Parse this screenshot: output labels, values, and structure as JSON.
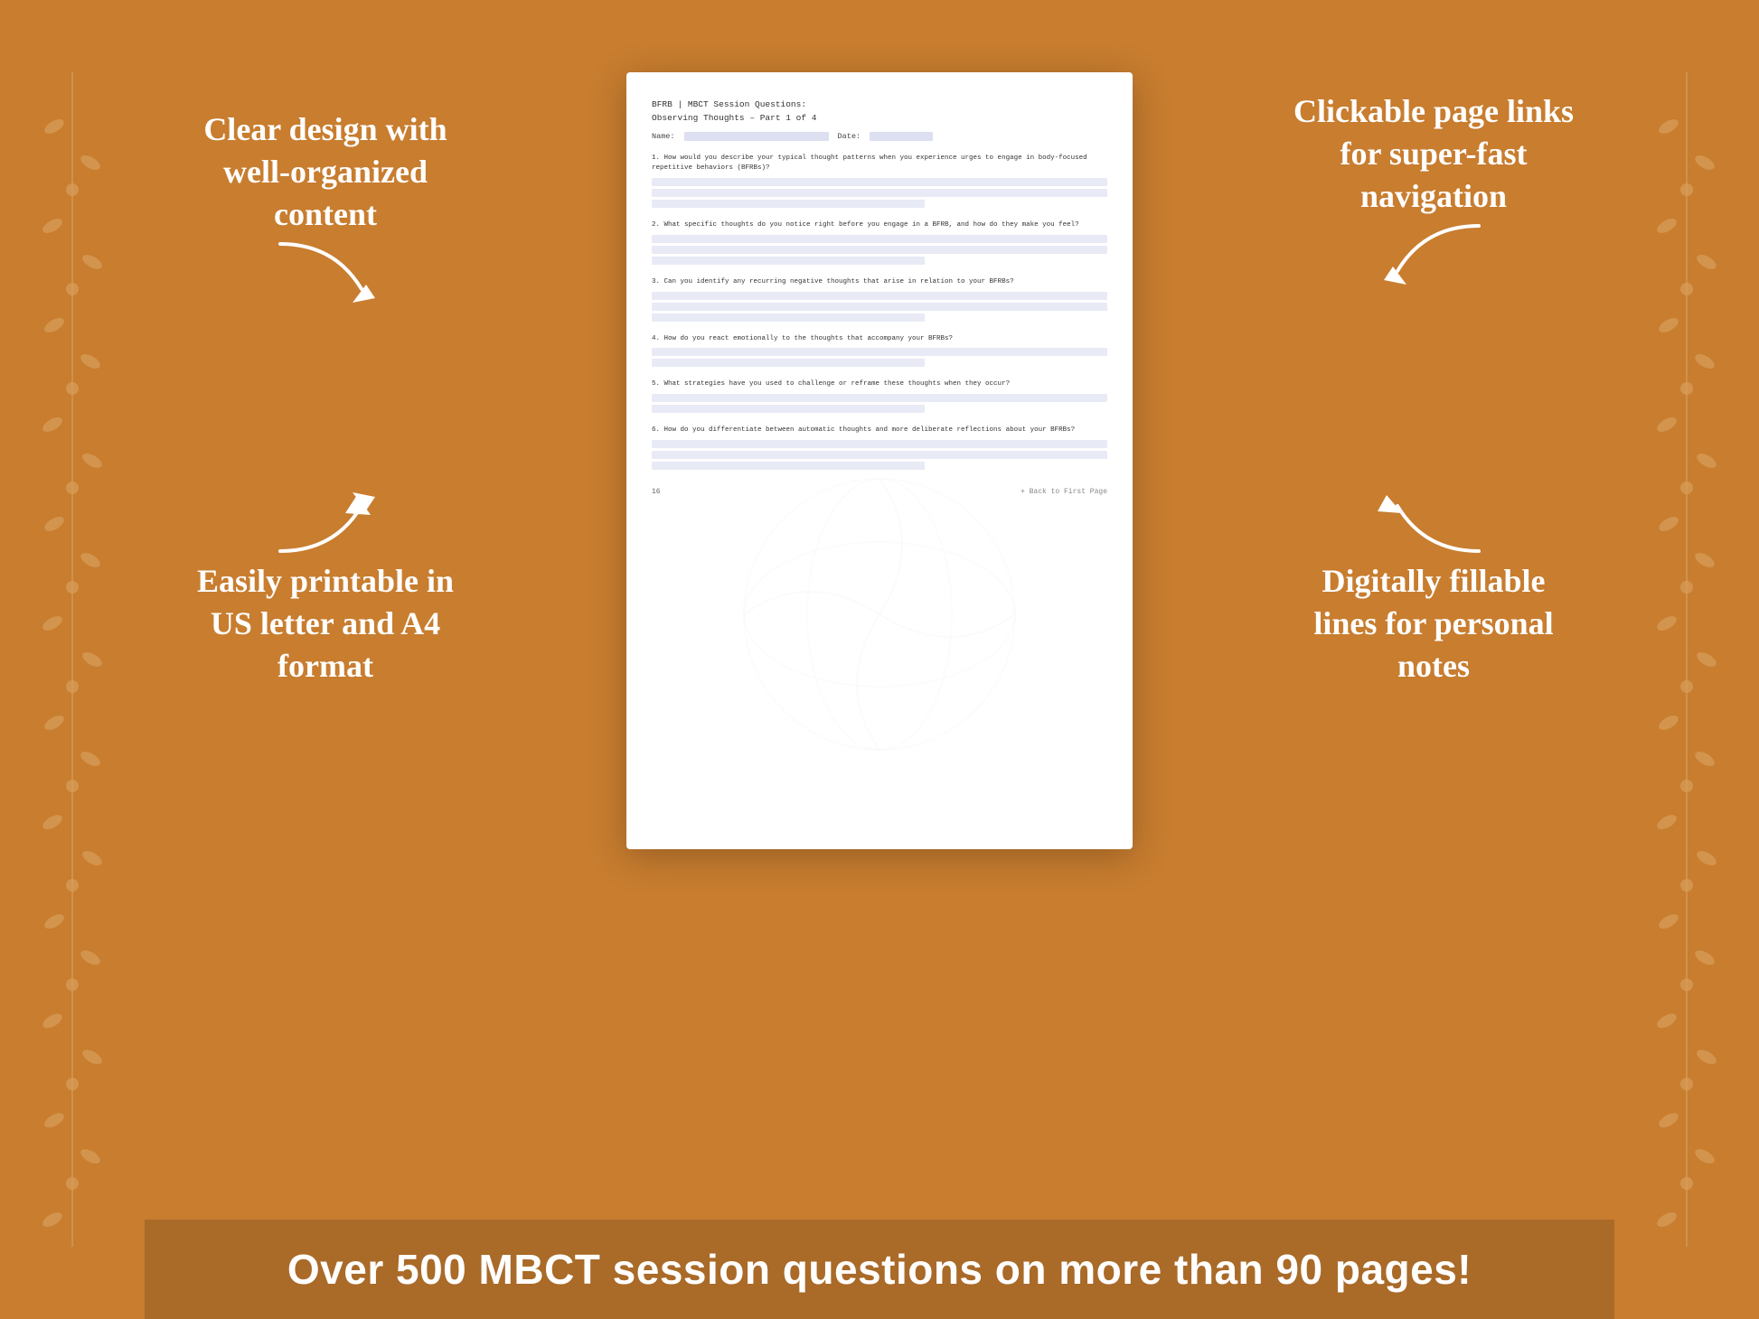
{
  "background_color": "#C87D2F",
  "left_annotations": {
    "top": {
      "text": "Clear design with well-organized content",
      "arrow_direction": "down-right"
    },
    "bottom": {
      "text": "Easily printable in US letter and A4 format",
      "arrow_direction": "down-right"
    }
  },
  "right_annotations": {
    "top": {
      "text": "Clickable page links for super-fast navigation",
      "arrow_direction": "left"
    },
    "bottom": {
      "text": "Digitally fillable lines for personal notes",
      "arrow_direction": "left"
    }
  },
  "document": {
    "header": "BFRB | MBCT Session Questions:",
    "title": "Observing Thoughts  – Part 1 of 4",
    "name_label": "Name:",
    "date_label": "Date:",
    "questions": [
      {
        "number": "1.",
        "text": "How would you describe your typical thought patterns when you experience urges to engage\nin body-focused repetitive behaviors (BFRBs)?",
        "answer_lines": 3
      },
      {
        "number": "2.",
        "text": "What specific thoughts do you notice right before you engage in a BFRB, and how do they\nmake you feel?",
        "answer_lines": 3
      },
      {
        "number": "3.",
        "text": "Can you identify any recurring negative thoughts that arise in relation to your BFRBs?",
        "answer_lines": 3
      },
      {
        "number": "4.",
        "text": "How do you react emotionally to the thoughts that accompany your BFRBs?",
        "answer_lines": 2
      },
      {
        "number": "5.",
        "text": "What strategies have you used to challenge or reframe these thoughts when they occur?",
        "answer_lines": 2
      },
      {
        "number": "6.",
        "text": "How do you differentiate between automatic thoughts and more deliberate reflections about\nyour BFRBs?",
        "answer_lines": 3
      }
    ],
    "page_number": "16",
    "back_link": "+ Back to First Page"
  },
  "bottom_banner": {
    "text": "Over 500 MBCT session questions on more than 90 pages!"
  }
}
